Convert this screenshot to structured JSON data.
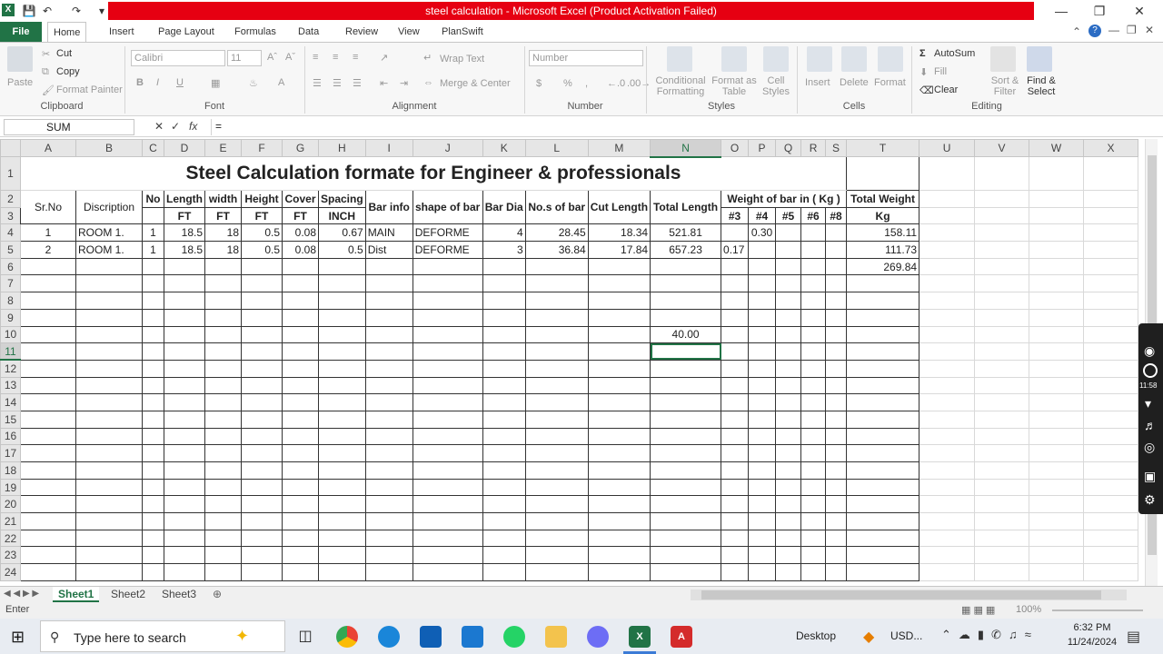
{
  "window": {
    "title": "steel calculation  -  Microsoft Excel (Product Activation Failed)"
  },
  "ribbon_tabs": [
    "File",
    "Home",
    "Insert",
    "Page Layout",
    "Formulas",
    "Data",
    "Review",
    "View",
    "PlanSwift"
  ],
  "ribbon": {
    "clipboard": {
      "paste": "Paste",
      "cut": "Cut",
      "copy": "Copy",
      "format_painter": "Format Painter",
      "label": "Clipboard"
    },
    "font": {
      "name": "Calibri",
      "size": "11",
      "label": "Font"
    },
    "alignment": {
      "wrap": "Wrap Text",
      "merge": "Merge & Center",
      "label": "Alignment"
    },
    "number": {
      "format": "Number",
      "currency": "$",
      "percent": "%",
      "comma": ",",
      "label": "Number"
    },
    "styles": {
      "conditional": "Conditional Formatting",
      "format_table": "Format as Table",
      "cell_styles": "Cell Styles",
      "label": "Styles"
    },
    "cells": {
      "insert": "Insert",
      "delete": "Delete",
      "format": "Format",
      "label": "Cells"
    },
    "editing": {
      "autosum": "AutoSum",
      "fill": "Fill",
      "clear": "Clear",
      "sort": "Sort & Filter",
      "find": "Find & Select",
      "label": "Editing"
    }
  },
  "formula_bar": {
    "name_box": "SUM",
    "fx": "fx",
    "content": "="
  },
  "columns": [
    "A",
    "B",
    "C",
    "D",
    "E",
    "F",
    "G",
    "H",
    "I",
    "J",
    "K",
    "L",
    "M",
    "N",
    "O",
    "P",
    "Q",
    "R",
    "S",
    "T",
    "U",
    "V",
    "W",
    "X"
  ],
  "sheet": {
    "title": "Steel Calculation formate for Engineer & professionals",
    "headers": {
      "srno": "Sr.No",
      "discription": "Discription",
      "no": "No",
      "length": "Length",
      "width": "width",
      "height": "Height",
      "cover": "Cover",
      "spacing": "Spacing",
      "barinfo": "Bar info",
      "shape": "shape of bar",
      "bardia": "Bar Dia",
      "nos": "No.s of bar",
      "cutlen": "Cut Length",
      "totallen": "Total Length",
      "weight": "Weight of bar in ( Kg )",
      "totalweight": "Total Weight"
    },
    "units": {
      "ft": "FT",
      "inch": "INCH",
      "kg": "Kg",
      "b3": "#3",
      "b4": "#4",
      "b5": "#5",
      "b6": "#6",
      "b8": "#8"
    },
    "rows": [
      {
        "srno": "1",
        "disc": "ROOM 1.",
        "no": "1",
        "len": "18.5",
        "wid": "18",
        "hgt": "0.5",
        "cov": "0.08",
        "spc": "0.67",
        "info": "MAIN",
        "shape": "DEFORME",
        "dia": "4",
        "nos": "28.45",
        "cut": "18.34",
        "total": "521.81",
        "w3": "",
        "w4": "0.30",
        "tw": "158.11"
      },
      {
        "srno": "2",
        "disc": "ROOM 1.",
        "no": "1",
        "len": "18.5",
        "wid": "18",
        "hgt": "0.5",
        "cov": "0.08",
        "spc": "0.5",
        "info": "Dist",
        "shape": "DEFORME",
        "dia": "3",
        "nos": "36.84",
        "cut": "17.84",
        "total": "657.23",
        "w3": "0.17",
        "w4": "",
        "tw": "111.73"
      }
    ],
    "grand_total": "269.84",
    "n10_value": "40.00"
  },
  "sheet_tabs": [
    "Sheet1",
    "Sheet2",
    "Sheet3"
  ],
  "status": {
    "mode": "Enter",
    "zoom": "100%"
  },
  "taskbar": {
    "search": "Type here to search",
    "desktop": "Desktop",
    "usd": "USD...",
    "time": "6:32 PM",
    "date": "11/24/2024"
  },
  "recorder": {
    "time": "11:58"
  }
}
